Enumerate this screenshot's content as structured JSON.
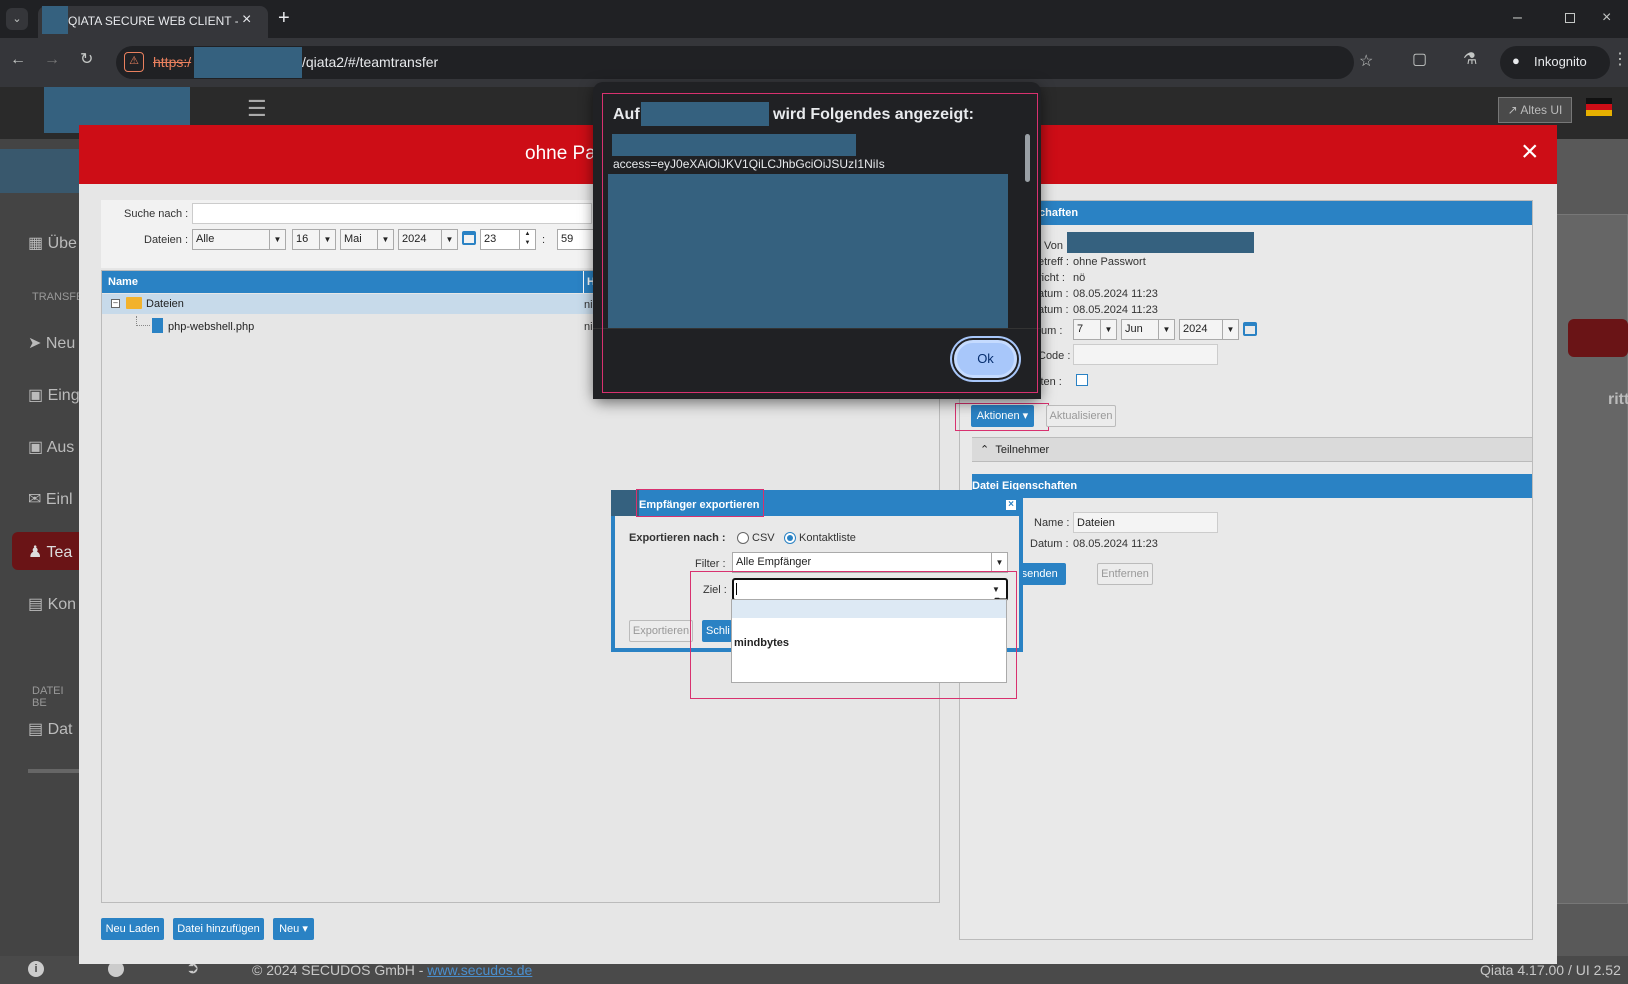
{
  "browser": {
    "tab_title": "QIATA SECURE WEB CLIENT - SE",
    "url_scheme": "https:/",
    "url_path": "/qiata2/#/teamtransfer",
    "incognito_label": "Inkognito"
  },
  "app": {
    "altes_ui": "Altes UI",
    "page_title_partial": "ohne Pa",
    "footer_copyright": "© 2024 SECUDOS GmbH - ",
    "footer_link": "www.secudos.de",
    "version": "Qiata 4.17.00 / UI 2.52",
    "right_partial_text": "ritt"
  },
  "sidebar": {
    "items": [
      "Übe",
      "Neu",
      "Eing",
      "Aus",
      "Einl",
      "Tea",
      "Kon",
      "Dat"
    ],
    "section_transfer": "TRANSFE",
    "section_datei": "DATEI BE"
  },
  "search": {
    "label": "Suche nach :",
    "dateien_label": "Dateien :",
    "filter_value": "Alle",
    "day": "16",
    "month": "Mai",
    "year": "2024",
    "hour": "23",
    "colon": ":",
    "minute": "59"
  },
  "tree": {
    "col_name": "Name",
    "col_h": "H",
    "root": "Dateien",
    "root_right": "ni",
    "file": "php-webshell.php",
    "file_right": "ni"
  },
  "bottom_buttons": {
    "neu_laden": "Neu Laden",
    "datei_hinzufuegen": "Datei hinzufügen",
    "neu": "Neu"
  },
  "props": {
    "title": "nsfer Eigenschaften",
    "von_label": "Von",
    "betreff_label": "etreff :",
    "betreff": "ohne Passwort",
    "bericht_label": "richt :",
    "bericht": "nö",
    "datum1_label": "atum :",
    "datum1": "08.05.2024 11:23",
    "datum2_label": "atum :",
    "datum2": "08.05.2024 11:23",
    "ablauf_label": "tum :",
    "ablauf_day": "7",
    "ablauf_month": "Jun",
    "ablauf_year": "2024",
    "code_label": "Code :",
    "halten_label": "lten :",
    "aktionen": "Aktionen",
    "aktualisieren": "Aktualisieren",
    "teilnehmer": "Teilnehmer",
    "datei_title": "Datei Eigenschaften",
    "name_label": "Name :",
    "name_value": "Dateien",
    "datum_label": "Datum :",
    "datum_value": "08.05.2024 11:23",
    "senden": "rsenden",
    "entfernen": "Entfernen"
  },
  "alert": {
    "title_prefix": "Auf",
    "title_suffix": "wird Folgendes angezeigt:",
    "access_text": "access=eyJ0eXAiOiJKV1QiLCJhbGciOiJSUzI1NiIs",
    "ok": "Ok"
  },
  "export_dialog": {
    "title": "Empfänger exportieren",
    "export_label": "Exportieren nach :",
    "csv": "CSV",
    "kontaktliste": "Kontaktliste",
    "filter_label": "Filter :",
    "filter_value": "Alle Empfänger",
    "ziel_label": "Ziel :",
    "ziel_value": "",
    "options": [
      "",
      "mindbytes"
    ],
    "exportieren": "Exportieren",
    "schliessen": "Schli"
  }
}
